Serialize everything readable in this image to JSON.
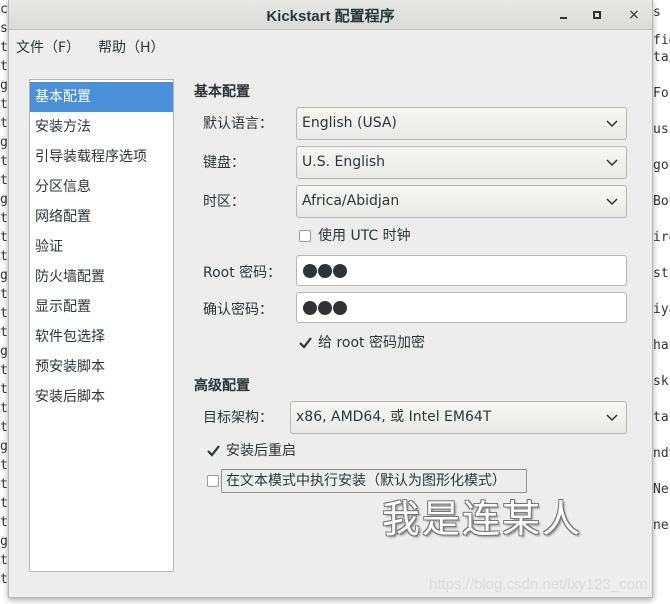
{
  "background": {
    "left_strip": "c\ns\nt\nt\ng\nt\nt\ng\nt\nt\ng\nt\nt\nt\ng\nt\nt\nt\ng\nt\nt\nt\nt\ng\nt\nt\nt\nt\ng\nt\nt",
    "right_strip": [
      "s",
      "fig",
      "ta/",
      "For",
      "usi",
      "gon",
      "Bou",
      "iro",
      "st",
      "iya",
      "hau",
      "sk",
      "ta",
      "ndy",
      "Ne",
      "ne"
    ]
  },
  "window": {
    "title": "Kickstart 配置程序",
    "close_glyph": "×"
  },
  "menu": {
    "file": "文件（F）",
    "help": "帮助（H）"
  },
  "sidebar": {
    "items": [
      {
        "label": "基本配置",
        "selected": true
      },
      {
        "label": "安装方法",
        "selected": false
      },
      {
        "label": "引导装载程序选项",
        "selected": false
      },
      {
        "label": "分区信息",
        "selected": false
      },
      {
        "label": "网络配置",
        "selected": false
      },
      {
        "label": "验证",
        "selected": false
      },
      {
        "label": "防火墙配置",
        "selected": false
      },
      {
        "label": "显示配置",
        "selected": false
      },
      {
        "label": "软件包选择",
        "selected": false
      },
      {
        "label": "预安装脚本",
        "selected": false
      },
      {
        "label": "安装后脚本",
        "selected": false
      }
    ]
  },
  "basic": {
    "section_title": "基本配置",
    "language_label": "默认语言：",
    "language_value": "English (USA)",
    "keyboard_label": "键盘：",
    "keyboard_value": "U.S. English",
    "timezone_label": "时区：",
    "timezone_value": "Africa/Abidjan",
    "utc_label": "使用  UTC 时钟",
    "utc_checked": false,
    "root_pw_label": "Root 密码：",
    "confirm_pw_label": "确认密码：",
    "encrypt_label": "给  root 密码加密",
    "encrypt_checked": true
  },
  "advanced": {
    "section_title": "高级配置",
    "arch_label": "目标架构：",
    "arch_value": "x86, AMD64, 或  Intel EM64T",
    "reboot_label": "安装后重启",
    "reboot_checked": true,
    "textmode_label": "在文本模式中执行安装（默认为图形化模式）",
    "textmode_checked": false
  },
  "watermarks": {
    "handwritten": "我是连某人",
    "url": "https://blog.csdn.net/lxy123_com"
  },
  "colors": {
    "selection": "#4a90d9",
    "window_bg": "#ededed",
    "text": "#2e3436"
  }
}
